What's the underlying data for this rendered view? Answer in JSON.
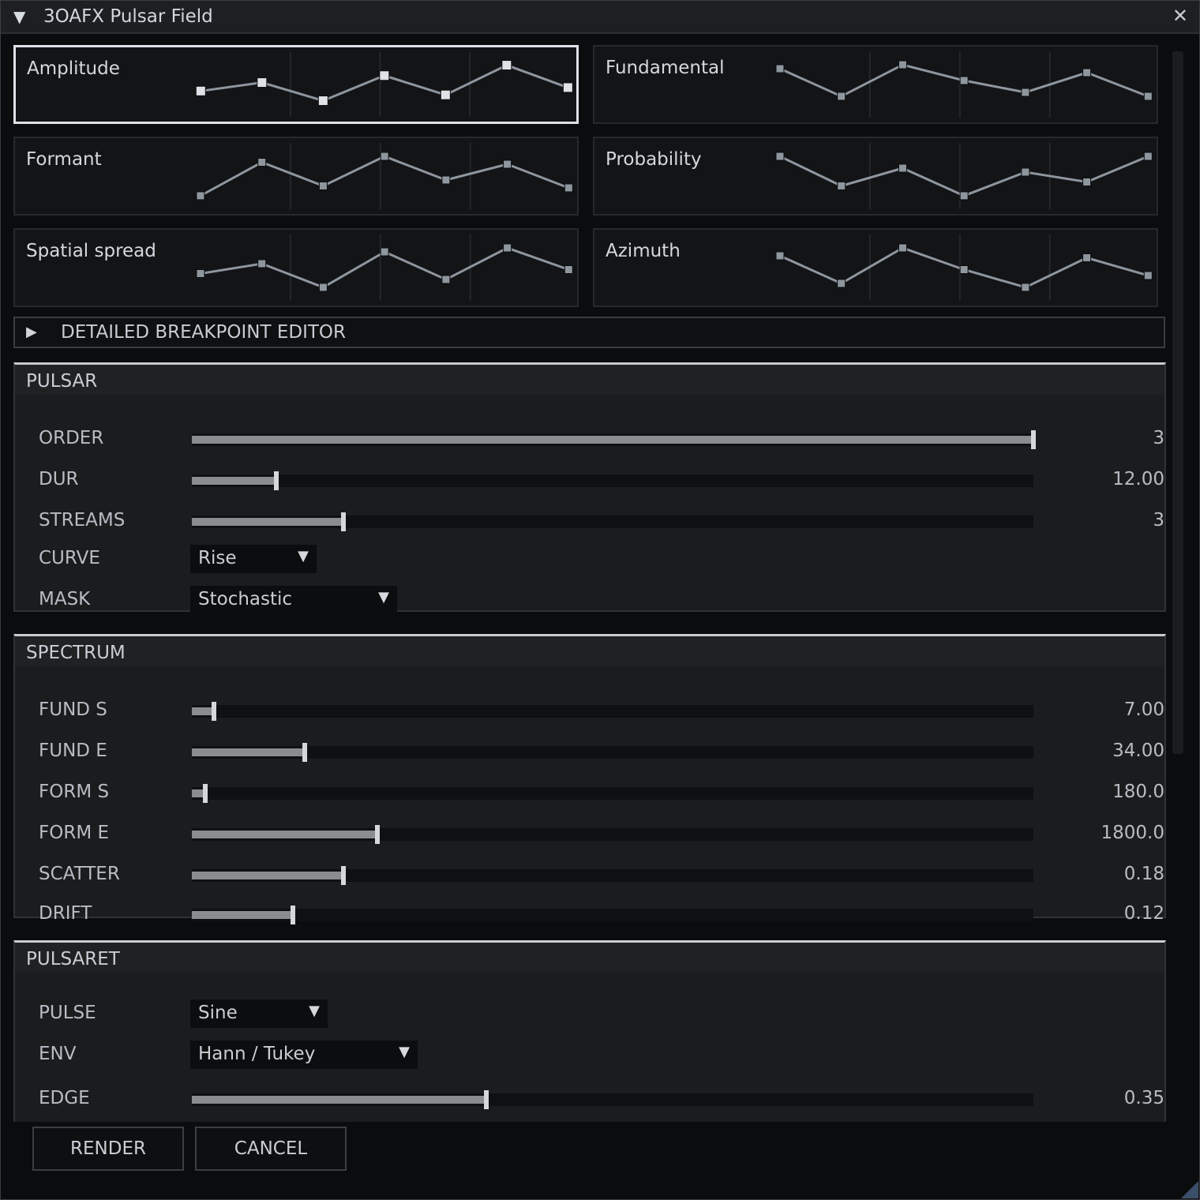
{
  "window": {
    "title": "3OAFX Pulsar Field",
    "collapse_icon": "▼",
    "close_icon": "✕"
  },
  "graphs": [
    {
      "label": "Amplitude",
      "selected": true,
      "points": [
        0.33,
        0.55,
        0.08,
        0.73,
        0.23,
        1.0,
        0.42
      ]
    },
    {
      "label": "Fundamental",
      "selected": false,
      "points": [
        0.9,
        0.2,
        1.0,
        0.6,
        0.3,
        0.8,
        0.2
      ]
    },
    {
      "label": "Formant",
      "selected": false,
      "points": [
        0.0,
        0.85,
        0.25,
        1.0,
        0.4,
        0.8,
        0.2
      ]
    },
    {
      "label": "Probability",
      "selected": false,
      "points": [
        1.0,
        0.25,
        0.7,
        0.0,
        0.6,
        0.35,
        1.0
      ]
    },
    {
      "label": "Spatial spread",
      "selected": false,
      "points": [
        0.35,
        0.6,
        0.0,
        0.9,
        0.2,
        1.0,
        0.45
      ]
    },
    {
      "label": "Azimuth",
      "selected": false,
      "points": [
        0.8,
        0.1,
        1.0,
        0.45,
        0.0,
        0.75,
        0.3
      ]
    }
  ],
  "breakpoint_editor": {
    "label": "DETAILED BREAKPOINT EDITOR",
    "expand_icon": "▶"
  },
  "pulsar": {
    "title": "PULSAR",
    "sliders": [
      {
        "label": "ORDER",
        "value": "3",
        "fraction": 1.0
      },
      {
        "label": "DUR",
        "value": "12.00",
        "fraction": 0.1
      },
      {
        "label": "STREAMS",
        "value": "3",
        "fraction": 0.18
      }
    ],
    "dropdowns": [
      {
        "label": "CURVE",
        "value": "Rise",
        "arrow": "▼"
      },
      {
        "label": "MASK",
        "value": "Stochastic",
        "arrow": "▼"
      }
    ]
  },
  "spectrum": {
    "title": "SPECTRUM",
    "sliders": [
      {
        "label": "FUND S",
        "value": "7.00",
        "fraction": 0.026
      },
      {
        "label": "FUND E",
        "value": "34.00",
        "fraction": 0.134
      },
      {
        "label": "FORM S",
        "value": "180.0",
        "fraction": 0.016
      },
      {
        "label": "FORM E",
        "value": "1800.0",
        "fraction": 0.22
      },
      {
        "label": "SCATTER",
        "value": "0.18",
        "fraction": 0.18
      },
      {
        "label": "DRIFT",
        "value": "0.12",
        "fraction": 0.12
      }
    ]
  },
  "pulsaret": {
    "title": "PULSARET",
    "dropdowns": [
      {
        "label": "PULSE",
        "value": "Sine",
        "arrow": "▼"
      },
      {
        "label": "ENV",
        "value": "Hann / Tukey",
        "arrow": "▼"
      }
    ],
    "sliders": [
      {
        "label": "EDGE",
        "value": "0.35",
        "fraction": 0.35
      }
    ]
  },
  "buttons": {
    "render": "RENDER",
    "cancel": "CANCEL"
  }
}
